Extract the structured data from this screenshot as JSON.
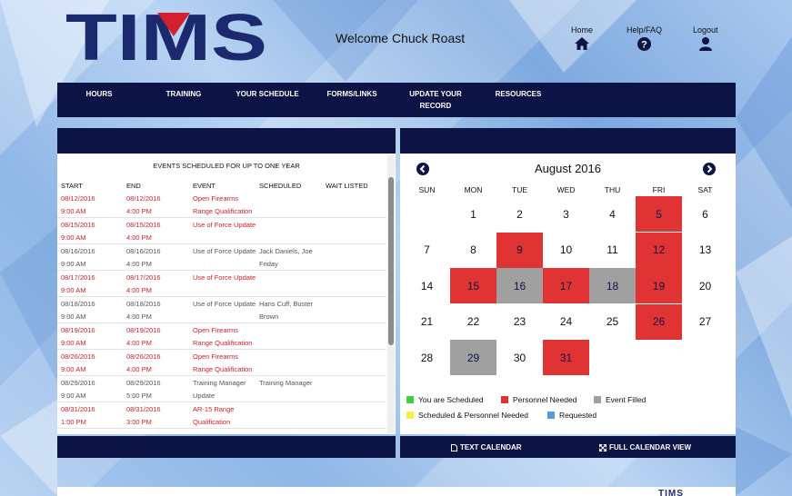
{
  "header": {
    "logo_text": "TIMS",
    "welcome": "Welcome Chuck Roast",
    "links": [
      {
        "label": "Home",
        "icon": "home-icon"
      },
      {
        "label": "Help/FAQ",
        "icon": "question-circle-icon"
      },
      {
        "label": "Logout",
        "icon": "user-icon"
      }
    ]
  },
  "nav": {
    "items": [
      {
        "line1": "HOURS",
        "line2": ""
      },
      {
        "line1": "TRAINING",
        "line2": ""
      },
      {
        "line1": "YOUR SCHEDULE",
        "line2": ""
      },
      {
        "line1": "FORMS/LINKS",
        "line2": ""
      },
      {
        "line1": "UPDATE YOUR",
        "line2": "RECORD"
      },
      {
        "line1": "RESOURCES",
        "line2": ""
      }
    ]
  },
  "events": {
    "title": "EVENTS SCHEDULED FOR UP TO ONE YEAR",
    "columns": [
      "START",
      "END",
      "EVENT",
      "SCHEDULED",
      "WAIT LISTED"
    ],
    "rows": [
      {
        "status": "red",
        "start_date": "08/12/2016",
        "start_time": "9:00 AM",
        "end_date": "08/12/2016",
        "end_time": "4:00 PM",
        "event_1": "Open Firearms",
        "event_2": "Range Qualification",
        "sched_1": "",
        "sched_2": ""
      },
      {
        "status": "red",
        "start_date": "08/15/2016",
        "start_time": "9:00 AM",
        "end_date": "08/15/2016",
        "end_time": "4:00 PM",
        "event_1": "Use of Force Update",
        "event_2": "",
        "sched_1": "",
        "sched_2": ""
      },
      {
        "status": "gray",
        "start_date": "08/16/2016",
        "start_time": "9:00 AM",
        "end_date": "08/16/2016",
        "end_time": "4:00 PM",
        "event_1": "Use of Force Update",
        "event_2": "",
        "sched_1": "Jack Daniels, Joe",
        "sched_2": "Friday"
      },
      {
        "status": "red",
        "start_date": "08/17/2016",
        "start_time": "9:00 AM",
        "end_date": "08/17/2016",
        "end_time": "4:00 PM",
        "event_1": "Use of Force Update",
        "event_2": "",
        "sched_1": "",
        "sched_2": ""
      },
      {
        "status": "gray",
        "start_date": "08/18/2016",
        "start_time": "9:00 AM",
        "end_date": "08/18/2016",
        "end_time": "4:00 PM",
        "event_1": "Use of Force Update",
        "event_2": "",
        "sched_1": "Hans Cuff, Buster",
        "sched_2": "Brown"
      },
      {
        "status": "red",
        "start_date": "08/19/2016",
        "start_time": "9:00 AM",
        "end_date": "08/19/2016",
        "end_time": "4:00 PM",
        "event_1": "Open Firearms",
        "event_2": "Range Qualification",
        "sched_1": "",
        "sched_2": ""
      },
      {
        "status": "red",
        "start_date": "08/26/2016",
        "start_time": "9:00 AM",
        "end_date": "08/26/2016",
        "end_time": "4:00 PM",
        "event_1": "Open Firearms",
        "event_2": "Range Qualification",
        "sched_1": "",
        "sched_2": ""
      },
      {
        "status": "gray",
        "start_date": "08/29/2016",
        "start_time": "9:00 AM",
        "end_date": "08/29/2016",
        "end_time": "5:00 PM",
        "event_1": "Training Manager",
        "event_2": "Update",
        "sched_1": "Training Manager",
        "sched_2": ""
      },
      {
        "status": "red",
        "start_date": "08/31/2016",
        "start_time": "1:00 PM",
        "end_date": "08/31/2016",
        "end_time": "3:00 PM",
        "event_1": "AR-15 Range",
        "event_2": "Qualification",
        "sched_1": "",
        "sched_2": ""
      }
    ]
  },
  "calendar": {
    "title": "August 2016",
    "days_of_week": [
      "SUN",
      "MON",
      "TUE",
      "WED",
      "THU",
      "FRI",
      "SAT"
    ],
    "weeks": [
      [
        {
          "d": "",
          "s": ""
        },
        {
          "d": "1",
          "s": ""
        },
        {
          "d": "2",
          "s": ""
        },
        {
          "d": "3",
          "s": ""
        },
        {
          "d": "4",
          "s": ""
        },
        {
          "d": "5",
          "s": "red"
        },
        {
          "d": "6",
          "s": ""
        }
      ],
      [
        {
          "d": "7",
          "s": ""
        },
        {
          "d": "8",
          "s": ""
        },
        {
          "d": "9",
          "s": "red"
        },
        {
          "d": "10",
          "s": ""
        },
        {
          "d": "11",
          "s": ""
        },
        {
          "d": "12",
          "s": "red"
        },
        {
          "d": "13",
          "s": ""
        }
      ],
      [
        {
          "d": "14",
          "s": ""
        },
        {
          "d": "15",
          "s": "red"
        },
        {
          "d": "16",
          "s": "gray"
        },
        {
          "d": "17",
          "s": "red"
        },
        {
          "d": "18",
          "s": "gray"
        },
        {
          "d": "19",
          "s": "red"
        },
        {
          "d": "20",
          "s": ""
        }
      ],
      [
        {
          "d": "21",
          "s": ""
        },
        {
          "d": "22",
          "s": ""
        },
        {
          "d": "23",
          "s": ""
        },
        {
          "d": "24",
          "s": ""
        },
        {
          "d": "25",
          "s": ""
        },
        {
          "d": "26",
          "s": "red"
        },
        {
          "d": "27",
          "s": ""
        }
      ],
      [
        {
          "d": "28",
          "s": ""
        },
        {
          "d": "29",
          "s": "gray"
        },
        {
          "d": "30",
          "s": ""
        },
        {
          "d": "31",
          "s": "red"
        },
        {
          "d": "",
          "s": ""
        },
        {
          "d": "",
          "s": ""
        },
        {
          "d": "",
          "s": ""
        }
      ]
    ],
    "legend": [
      {
        "label": "You are Scheduled",
        "color": "#3fd13f"
      },
      {
        "label": "Personnel Needed",
        "color": "#e03434"
      },
      {
        "label": "Event Filled",
        "color": "#a0a0a0"
      },
      {
        "label": "Scheduled & Personnel Needed",
        "color": "#f5f03a"
      },
      {
        "label": "Requested",
        "color": "#4f9fe0"
      }
    ]
  },
  "footer": {
    "text_calendar": "TEXT CALENDAR",
    "full_calendar": "FULL CALENDAR VIEW",
    "mini_logo": "TIMS"
  },
  "colors": {
    "navy": "#0c1445",
    "event_red": "#d0202a",
    "logo_red": "#d32030"
  }
}
